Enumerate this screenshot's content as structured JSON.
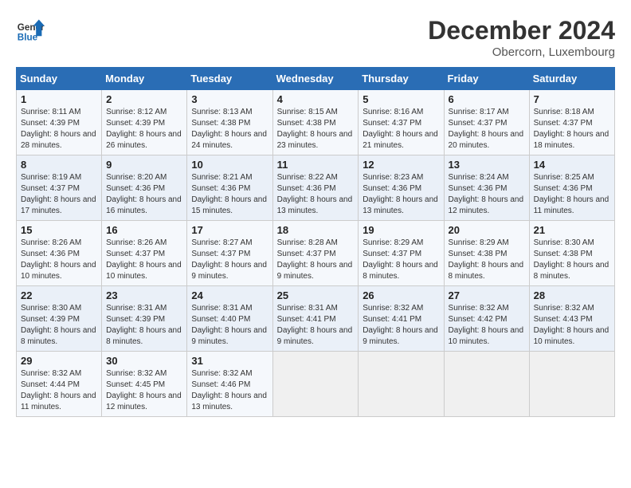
{
  "header": {
    "logo_line1": "General",
    "logo_line2": "Blue",
    "month_title": "December 2024",
    "location": "Obercorn, Luxembourg"
  },
  "weekdays": [
    "Sunday",
    "Monday",
    "Tuesday",
    "Wednesday",
    "Thursday",
    "Friday",
    "Saturday"
  ],
  "weeks": [
    [
      {
        "day": "1",
        "sunrise": "8:11 AM",
        "sunset": "4:39 PM",
        "daylight": "8 hours and 28 minutes."
      },
      {
        "day": "2",
        "sunrise": "8:12 AM",
        "sunset": "4:39 PM",
        "daylight": "8 hours and 26 minutes."
      },
      {
        "day": "3",
        "sunrise": "8:13 AM",
        "sunset": "4:38 PM",
        "daylight": "8 hours and 24 minutes."
      },
      {
        "day": "4",
        "sunrise": "8:15 AM",
        "sunset": "4:38 PM",
        "daylight": "8 hours and 23 minutes."
      },
      {
        "day": "5",
        "sunrise": "8:16 AM",
        "sunset": "4:37 PM",
        "daylight": "8 hours and 21 minutes."
      },
      {
        "day": "6",
        "sunrise": "8:17 AM",
        "sunset": "4:37 PM",
        "daylight": "8 hours and 20 minutes."
      },
      {
        "day": "7",
        "sunrise": "8:18 AM",
        "sunset": "4:37 PM",
        "daylight": "8 hours and 18 minutes."
      }
    ],
    [
      {
        "day": "8",
        "sunrise": "8:19 AM",
        "sunset": "4:37 PM",
        "daylight": "8 hours and 17 minutes."
      },
      {
        "day": "9",
        "sunrise": "8:20 AM",
        "sunset": "4:36 PM",
        "daylight": "8 hours and 16 minutes."
      },
      {
        "day": "10",
        "sunrise": "8:21 AM",
        "sunset": "4:36 PM",
        "daylight": "8 hours and 15 minutes."
      },
      {
        "day": "11",
        "sunrise": "8:22 AM",
        "sunset": "4:36 PM",
        "daylight": "8 hours and 13 minutes."
      },
      {
        "day": "12",
        "sunrise": "8:23 AM",
        "sunset": "4:36 PM",
        "daylight": "8 hours and 13 minutes."
      },
      {
        "day": "13",
        "sunrise": "8:24 AM",
        "sunset": "4:36 PM",
        "daylight": "8 hours and 12 minutes."
      },
      {
        "day": "14",
        "sunrise": "8:25 AM",
        "sunset": "4:36 PM",
        "daylight": "8 hours and 11 minutes."
      }
    ],
    [
      {
        "day": "15",
        "sunrise": "8:26 AM",
        "sunset": "4:36 PM",
        "daylight": "8 hours and 10 minutes."
      },
      {
        "day": "16",
        "sunrise": "8:26 AM",
        "sunset": "4:37 PM",
        "daylight": "8 hours and 10 minutes."
      },
      {
        "day": "17",
        "sunrise": "8:27 AM",
        "sunset": "4:37 PM",
        "daylight": "8 hours and 9 minutes."
      },
      {
        "day": "18",
        "sunrise": "8:28 AM",
        "sunset": "4:37 PM",
        "daylight": "8 hours and 9 minutes."
      },
      {
        "day": "19",
        "sunrise": "8:29 AM",
        "sunset": "4:37 PM",
        "daylight": "8 hours and 8 minutes."
      },
      {
        "day": "20",
        "sunrise": "8:29 AM",
        "sunset": "4:38 PM",
        "daylight": "8 hours and 8 minutes."
      },
      {
        "day": "21",
        "sunrise": "8:30 AM",
        "sunset": "4:38 PM",
        "daylight": "8 hours and 8 minutes."
      }
    ],
    [
      {
        "day": "22",
        "sunrise": "8:30 AM",
        "sunset": "4:39 PM",
        "daylight": "8 hours and 8 minutes."
      },
      {
        "day": "23",
        "sunrise": "8:31 AM",
        "sunset": "4:39 PM",
        "daylight": "8 hours and 8 minutes."
      },
      {
        "day": "24",
        "sunrise": "8:31 AM",
        "sunset": "4:40 PM",
        "daylight": "8 hours and 9 minutes."
      },
      {
        "day": "25",
        "sunrise": "8:31 AM",
        "sunset": "4:41 PM",
        "daylight": "8 hours and 9 minutes."
      },
      {
        "day": "26",
        "sunrise": "8:32 AM",
        "sunset": "4:41 PM",
        "daylight": "8 hours and 9 minutes."
      },
      {
        "day": "27",
        "sunrise": "8:32 AM",
        "sunset": "4:42 PM",
        "daylight": "8 hours and 10 minutes."
      },
      {
        "day": "28",
        "sunrise": "8:32 AM",
        "sunset": "4:43 PM",
        "daylight": "8 hours and 10 minutes."
      }
    ],
    [
      {
        "day": "29",
        "sunrise": "8:32 AM",
        "sunset": "4:44 PM",
        "daylight": "8 hours and 11 minutes."
      },
      {
        "day": "30",
        "sunrise": "8:32 AM",
        "sunset": "4:45 PM",
        "daylight": "8 hours and 12 minutes."
      },
      {
        "day": "31",
        "sunrise": "8:32 AM",
        "sunset": "4:46 PM",
        "daylight": "8 hours and 13 minutes."
      },
      null,
      null,
      null,
      null
    ]
  ]
}
